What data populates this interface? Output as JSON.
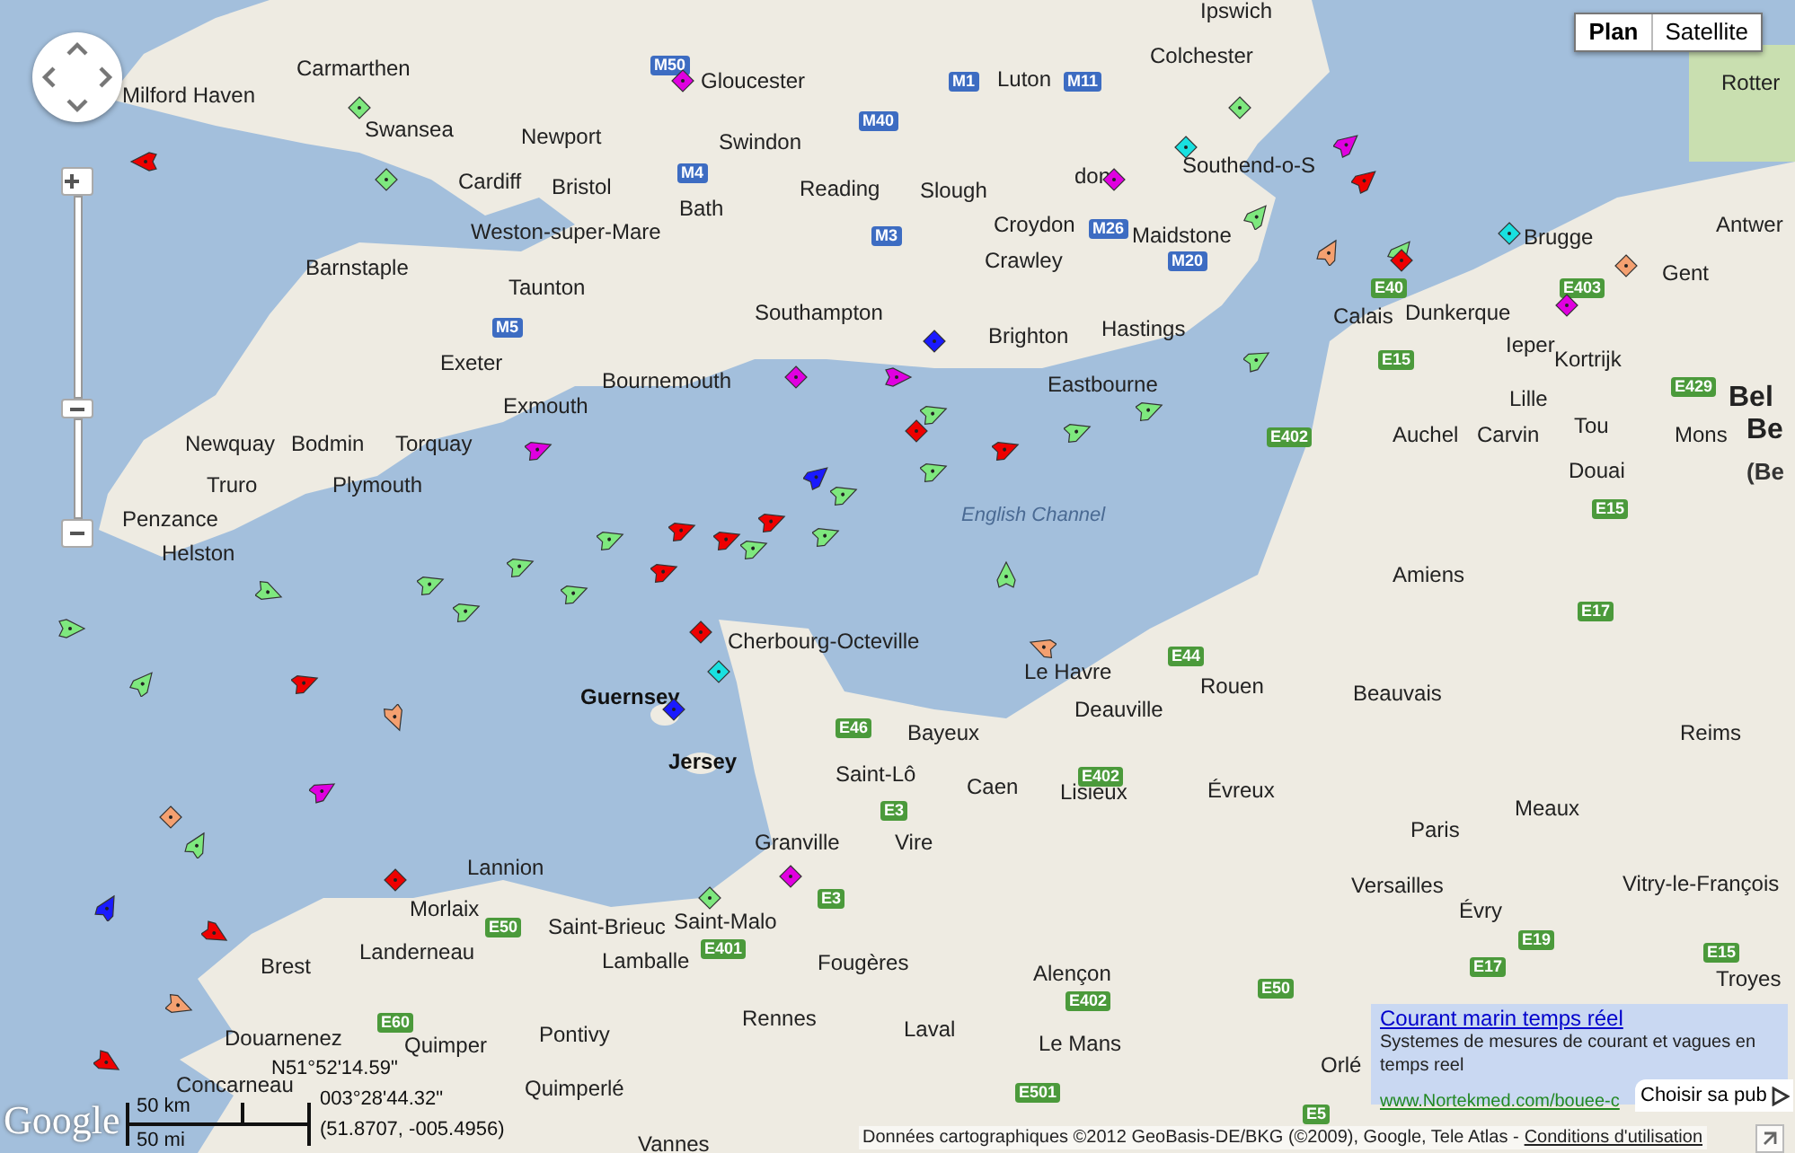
{
  "map_type_tabs": [
    {
      "label": "Plan",
      "selected": true
    },
    {
      "label": "Satellite",
      "selected": false
    }
  ],
  "places": [
    {
      "name": "Carmarthen",
      "kind": "town"
    },
    {
      "name": "Milford Haven",
      "kind": "town"
    },
    {
      "name": "Gloucester",
      "kind": "town"
    },
    {
      "name": "Luton",
      "kind": "town"
    },
    {
      "name": "Ipswich",
      "kind": "town"
    },
    {
      "name": "Colchester",
      "kind": "town"
    },
    {
      "name": "Swansea",
      "kind": "town"
    },
    {
      "name": "Newport",
      "kind": "town"
    },
    {
      "name": "Swindon",
      "kind": "town"
    },
    {
      "name": "Cardiff",
      "kind": "town"
    },
    {
      "name": "Bristol",
      "kind": "town"
    },
    {
      "name": "Reading",
      "kind": "town"
    },
    {
      "name": "Slough",
      "kind": "town"
    },
    {
      "name": "don",
      "kind": "town"
    },
    {
      "name": "Southend-o-S",
      "kind": "town"
    },
    {
      "name": "Weston-super-Mare",
      "kind": "town"
    },
    {
      "name": "Bath",
      "kind": "town"
    },
    {
      "name": "Croydon",
      "kind": "town"
    },
    {
      "name": "Maidstone",
      "kind": "town"
    },
    {
      "name": "Barnstaple",
      "kind": "town"
    },
    {
      "name": "Taunton",
      "kind": "town"
    },
    {
      "name": "Crawley",
      "kind": "town"
    },
    {
      "name": "Southampton",
      "kind": "town"
    },
    {
      "name": "Brighton",
      "kind": "town"
    },
    {
      "name": "Hastings",
      "kind": "town"
    },
    {
      "name": "Exeter",
      "kind": "town"
    },
    {
      "name": "Bournemouth",
      "kind": "town"
    },
    {
      "name": "Eastbourne",
      "kind": "town"
    },
    {
      "name": "Exmouth",
      "kind": "town"
    },
    {
      "name": "Newquay",
      "kind": "town"
    },
    {
      "name": "Bodmin",
      "kind": "town"
    },
    {
      "name": "Torquay",
      "kind": "town"
    },
    {
      "name": "Plymouth",
      "kind": "town"
    },
    {
      "name": "Truro",
      "kind": "town"
    },
    {
      "name": "Penzance",
      "kind": "town"
    },
    {
      "name": "Helston",
      "kind": "town"
    },
    {
      "name": "English Channel",
      "kind": "water"
    },
    {
      "name": "Cherbourg-Octeville",
      "kind": "town"
    },
    {
      "name": "Guernsey",
      "kind": "island"
    },
    {
      "name": "Jersey",
      "kind": "island"
    },
    {
      "name": "Le Havre",
      "kind": "town"
    },
    {
      "name": "Deauville",
      "kind": "town"
    },
    {
      "name": "Rouen",
      "kind": "town"
    },
    {
      "name": "Bayeux",
      "kind": "town"
    },
    {
      "name": "Caen",
      "kind": "town"
    },
    {
      "name": "Lisieux",
      "kind": "town"
    },
    {
      "name": "Évreux",
      "kind": "town"
    },
    {
      "name": "Saint-Lô",
      "kind": "town"
    },
    {
      "name": "Vire",
      "kind": "town"
    },
    {
      "name": "Granville",
      "kind": "town"
    },
    {
      "name": "Amiens",
      "kind": "town"
    },
    {
      "name": "Beauvais",
      "kind": "town"
    },
    {
      "name": "Reims",
      "kind": "town"
    },
    {
      "name": "Paris",
      "kind": "town"
    },
    {
      "name": "Versailles",
      "kind": "town"
    },
    {
      "name": "Évry",
      "kind": "town"
    },
    {
      "name": "Meaux",
      "kind": "town"
    },
    {
      "name": "Vitry-le-François",
      "kind": "town"
    },
    {
      "name": "Saint-Brieuc",
      "kind": "town"
    },
    {
      "name": "Saint-Malo",
      "kind": "town"
    },
    {
      "name": "Lamballe",
      "kind": "town"
    },
    {
      "name": "Fougères",
      "kind": "town"
    },
    {
      "name": "Morlaix",
      "kind": "town"
    },
    {
      "name": "Lannion",
      "kind": "town"
    },
    {
      "name": "Landerneau",
      "kind": "town"
    },
    {
      "name": "Brest",
      "kind": "town"
    },
    {
      "name": "Alençon",
      "kind": "town"
    },
    {
      "name": "Pontivy",
      "kind": "town"
    },
    {
      "name": "Rennes",
      "kind": "town"
    },
    {
      "name": "Laval",
      "kind": "town"
    },
    {
      "name": "Le Mans",
      "kind": "town"
    },
    {
      "name": "Quimperlé",
      "kind": "town"
    },
    {
      "name": "Douarnenez",
      "kind": "town"
    },
    {
      "name": "Quimper",
      "kind": "town"
    },
    {
      "name": "Concarneau",
      "kind": "town"
    },
    {
      "name": "Vannes",
      "kind": "town"
    },
    {
      "name": "Troyes",
      "kind": "town"
    },
    {
      "name": "Orlé",
      "kind": "town"
    },
    {
      "name": "Calais",
      "kind": "town"
    },
    {
      "name": "Dunkerque",
      "kind": "town"
    },
    {
      "name": "Brugge",
      "kind": "town"
    },
    {
      "name": "Ieper",
      "kind": "town"
    },
    {
      "name": "Kortrijk",
      "kind": "town"
    },
    {
      "name": "Lille",
      "kind": "town"
    },
    {
      "name": "Tou",
      "kind": "town"
    },
    {
      "name": "Mons",
      "kind": "town"
    },
    {
      "name": "Douai",
      "kind": "town"
    },
    {
      "name": "Auchel",
      "kind": "town"
    },
    {
      "name": "Carvin",
      "kind": "town"
    },
    {
      "name": "Gent",
      "kind": "town"
    },
    {
      "name": "Rotter",
      "kind": "town"
    },
    {
      "name": "Antwer",
      "kind": "town"
    },
    {
      "name": "Bel",
      "kind": "country"
    },
    {
      "name": "Be",
      "kind": "country"
    },
    {
      "name": "(Be",
      "kind": "country_sub"
    }
  ],
  "road_shields": [
    {
      "label": "M50",
      "kind": "motorway"
    },
    {
      "label": "M1",
      "kind": "motorway"
    },
    {
      "label": "M11",
      "kind": "motorway"
    },
    {
      "label": "M40",
      "kind": "motorway"
    },
    {
      "label": "M4",
      "kind": "motorway"
    },
    {
      "label": "M3",
      "kind": "motorway"
    },
    {
      "label": "M26",
      "kind": "motorway"
    },
    {
      "label": "M20",
      "kind": "motorway"
    },
    {
      "label": "M5",
      "kind": "motorway"
    },
    {
      "label": "E402",
      "kind": "euroroute"
    },
    {
      "label": "E15",
      "kind": "euroroute"
    },
    {
      "label": "E40",
      "kind": "euroroute"
    },
    {
      "label": "E403",
      "kind": "euroroute"
    },
    {
      "label": "E429",
      "kind": "euroroute"
    },
    {
      "label": "E15",
      "kind": "euroroute"
    },
    {
      "label": "E44",
      "kind": "euroroute"
    },
    {
      "label": "E46",
      "kind": "euroroute"
    },
    {
      "label": "E402",
      "kind": "euroroute"
    },
    {
      "label": "E3",
      "kind": "euroroute"
    },
    {
      "label": "E3",
      "kind": "euroroute"
    },
    {
      "label": "E50",
      "kind": "euroroute"
    },
    {
      "label": "E401",
      "kind": "euroroute"
    },
    {
      "label": "E17",
      "kind": "euroroute"
    },
    {
      "label": "E19",
      "kind": "euroroute"
    },
    {
      "label": "E17",
      "kind": "euroroute"
    },
    {
      "label": "E15",
      "kind": "euroroute"
    },
    {
      "label": "E402",
      "kind": "euroroute"
    },
    {
      "label": "E50",
      "kind": "euroroute"
    },
    {
      "label": "E501",
      "kind": "euroroute"
    },
    {
      "label": "E5",
      "kind": "euroroute"
    },
    {
      "label": "E60",
      "kind": "euroroute"
    }
  ],
  "ships": [
    {
      "kind": "underway",
      "color": "#7ee87e"
    },
    {
      "kind": "underway",
      "color": "#7ee87e"
    },
    {
      "kind": "underway",
      "color": "#7ee87e"
    },
    {
      "kind": "underway",
      "color": "#ee0000"
    },
    {
      "kind": "underway",
      "color": "#ee0000"
    },
    {
      "kind": "underway",
      "color": "#7ee87e"
    },
    {
      "kind": "underway",
      "color": "#7ee87e"
    },
    {
      "kind": "underway",
      "color": "#ee0000"
    },
    {
      "kind": "underway",
      "color": "#7ee87e"
    },
    {
      "kind": "underway",
      "color": "#7ee87e"
    },
    {
      "kind": "underway",
      "color": "#7ee87e"
    },
    {
      "kind": "underway",
      "color": "#7ee87e"
    },
    {
      "kind": "underway",
      "color": "#ee0000"
    },
    {
      "kind": "underway",
      "color": "#7ee87e"
    },
    {
      "kind": "underway",
      "color": "#7ee87e"
    },
    {
      "kind": "underway",
      "color": "#1a1aff"
    },
    {
      "kind": "underway",
      "color": "#ee0000"
    },
    {
      "kind": "underway",
      "color": "#7ee87e"
    },
    {
      "kind": "underway",
      "color": "#f4a070"
    },
    {
      "kind": "underway",
      "color": "#e000e0"
    },
    {
      "kind": "underway",
      "color": "#ee0000"
    },
    {
      "kind": "underway",
      "color": "#7ee87e"
    },
    {
      "kind": "underway",
      "color": "#f4a070"
    },
    {
      "kind": "underway",
      "color": "#e000e0"
    },
    {
      "kind": "underway",
      "color": "#7ee87e"
    },
    {
      "kind": "underway",
      "color": "#ee0000"
    },
    {
      "kind": "underway",
      "color": "#1a1aff"
    },
    {
      "kind": "underway",
      "color": "#7ee87e"
    },
    {
      "kind": "underway",
      "color": "#f4a070"
    },
    {
      "kind": "underway",
      "color": "#ee0000"
    },
    {
      "kind": "underway",
      "color": "#7ee87e"
    },
    {
      "kind": "underway",
      "color": "#e000e0"
    },
    {
      "kind": "underway",
      "color": "#7ee87e"
    },
    {
      "kind": "underway",
      "color": "#ee0000"
    },
    {
      "kind": "underway",
      "color": "#7ee87e"
    },
    {
      "kind": "underway",
      "color": "#f4a070"
    },
    {
      "kind": "underway",
      "color": "#7ee87e"
    },
    {
      "kind": "underway",
      "color": "#ee0000"
    },
    {
      "kind": "underway",
      "color": "#7ee87e"
    },
    {
      "kind": "underway",
      "color": "#e000e0"
    },
    {
      "kind": "moored",
      "color": "#e000e0"
    },
    {
      "kind": "moored",
      "color": "#7ee87e"
    },
    {
      "kind": "moored",
      "color": "#ee0000"
    },
    {
      "kind": "moored",
      "color": "#19e0e0"
    },
    {
      "kind": "moored",
      "color": "#e000e0"
    },
    {
      "kind": "moored",
      "color": "#f4a070"
    },
    {
      "kind": "moored",
      "color": "#7ee87e"
    },
    {
      "kind": "moored",
      "color": "#1a1aff"
    },
    {
      "kind": "moored",
      "color": "#e000e0"
    },
    {
      "kind": "moored",
      "color": "#ee0000"
    },
    {
      "kind": "moored",
      "color": "#19e0e0"
    },
    {
      "kind": "moored",
      "color": "#7ee87e"
    },
    {
      "kind": "moored",
      "color": "#e000e0"
    },
    {
      "kind": "moored",
      "color": "#f4a070"
    },
    {
      "kind": "moored",
      "color": "#ee0000"
    },
    {
      "kind": "moored",
      "color": "#7ee87e"
    },
    {
      "kind": "moored",
      "color": "#e000e0"
    },
    {
      "kind": "moored",
      "color": "#19e0e0"
    },
    {
      "kind": "moored",
      "color": "#ee0000"
    },
    {
      "kind": "moored",
      "color": "#1a1aff"
    }
  ],
  "coordinates": {
    "dms_lat": "N51°52'14.59\"",
    "dms_lon": "003°28'44.32\"",
    "decimal": "(51.8707, -005.4956)"
  },
  "scale": {
    "metric": "50 km",
    "imperial": "50 mi"
  },
  "logo": "Google",
  "ad": {
    "title": "Courant marin temps réel",
    "text": "Systemes de mesures de courant et vagues en temps reel",
    "url": "www.Nortekmed.com/bouee-c",
    "choice": "Choisir sa pub"
  },
  "attribution": {
    "text": "Données cartographiques ©2012 GeoBasis-DE/BKG (©2009), Google, Tele Atlas -",
    "link": "Conditions d'utilisation"
  }
}
